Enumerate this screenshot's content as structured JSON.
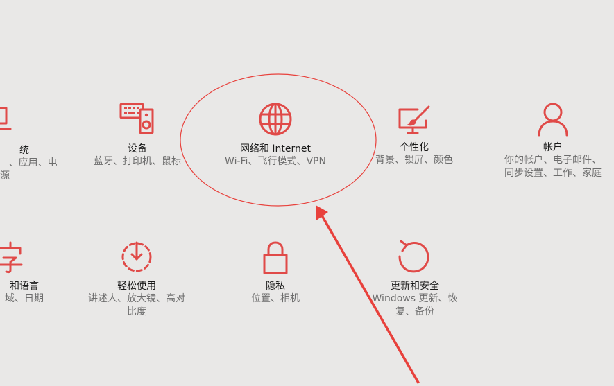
{
  "accent_color": "#e04a48",
  "annotation_color": "#e8413c",
  "tiles": [
    {
      "id": "system",
      "icon": "laptop-icon",
      "title": "统",
      "desc": [
        "、应用、电",
        "源"
      ]
    },
    {
      "id": "devices",
      "icon": "devices-icon",
      "title": "设备",
      "desc": [
        "蓝牙、打印机、鼠标"
      ]
    },
    {
      "id": "network",
      "icon": "globe-icon",
      "title": "网络和 Internet",
      "desc": [
        "Wi-Fi、飞行模式、VPN"
      ]
    },
    {
      "id": "personalization",
      "icon": "paint-monitor-icon",
      "title": "个性化",
      "desc": [
        "背景、锁屏、颜色"
      ]
    },
    {
      "id": "accounts",
      "icon": "person-icon",
      "title": "帐户",
      "desc": [
        "你的帐户、电子邮件、",
        "同步设置、工作、家庭"
      ]
    },
    {
      "id": "time-language",
      "icon": "language-icon",
      "title": "和语言",
      "desc": [
        "域、日期"
      ]
    },
    {
      "id": "ease-of-access",
      "icon": "ease-of-access-icon",
      "title": "轻松使用",
      "desc": [
        "讲述人、放大镜、高对",
        "比度"
      ]
    },
    {
      "id": "privacy",
      "icon": "lock-icon",
      "title": "隐私",
      "desc": [
        "位置、相机"
      ]
    },
    {
      "id": "update-security",
      "icon": "refresh-icon",
      "title": "更新和安全",
      "desc": [
        "Windows 更新、恢",
        "复、备份"
      ]
    }
  ]
}
